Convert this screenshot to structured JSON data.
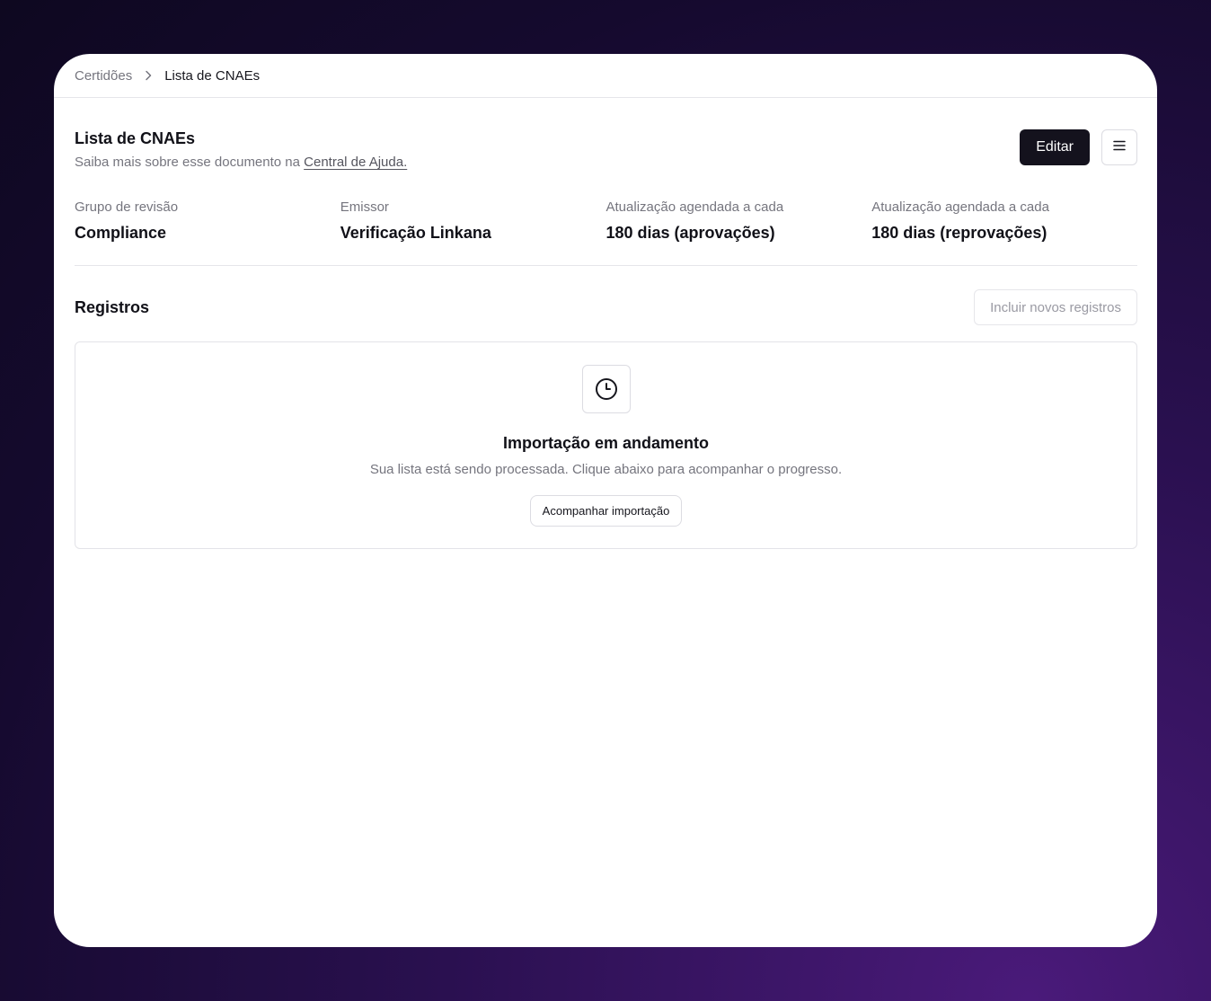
{
  "breadcrumb": {
    "parent": "Certidões",
    "current": "Lista de CNAEs"
  },
  "header": {
    "title": "Lista de CNAEs",
    "subtitle_prefix": "Saiba mais sobre esse documento na ",
    "help_link": "Central de Ajuda.",
    "edit_label": "Editar",
    "menu_icon": "menu-icon"
  },
  "info": [
    {
      "label": "Grupo de revisão",
      "value": "Compliance"
    },
    {
      "label": "Emissor",
      "value": "Verificação Linkana"
    },
    {
      "label": "Atualização agendada a cada",
      "value": "180 dias (aprovações)"
    },
    {
      "label": "Atualização agendada a cada",
      "value": "180 dias (reprovações)"
    }
  ],
  "records": {
    "title": "Registros",
    "add_label": "Incluir novos registros",
    "empty": {
      "icon": "clock-icon",
      "title": "Importação em andamento",
      "description": "Sua lista está sendo processada. Clique abaixo para acompanhar o progresso.",
      "button_label": "Acompanhar importação"
    }
  },
  "colors": {
    "primary": "#14121d",
    "muted_text": "#75757e",
    "border": "#e6e6ea"
  }
}
